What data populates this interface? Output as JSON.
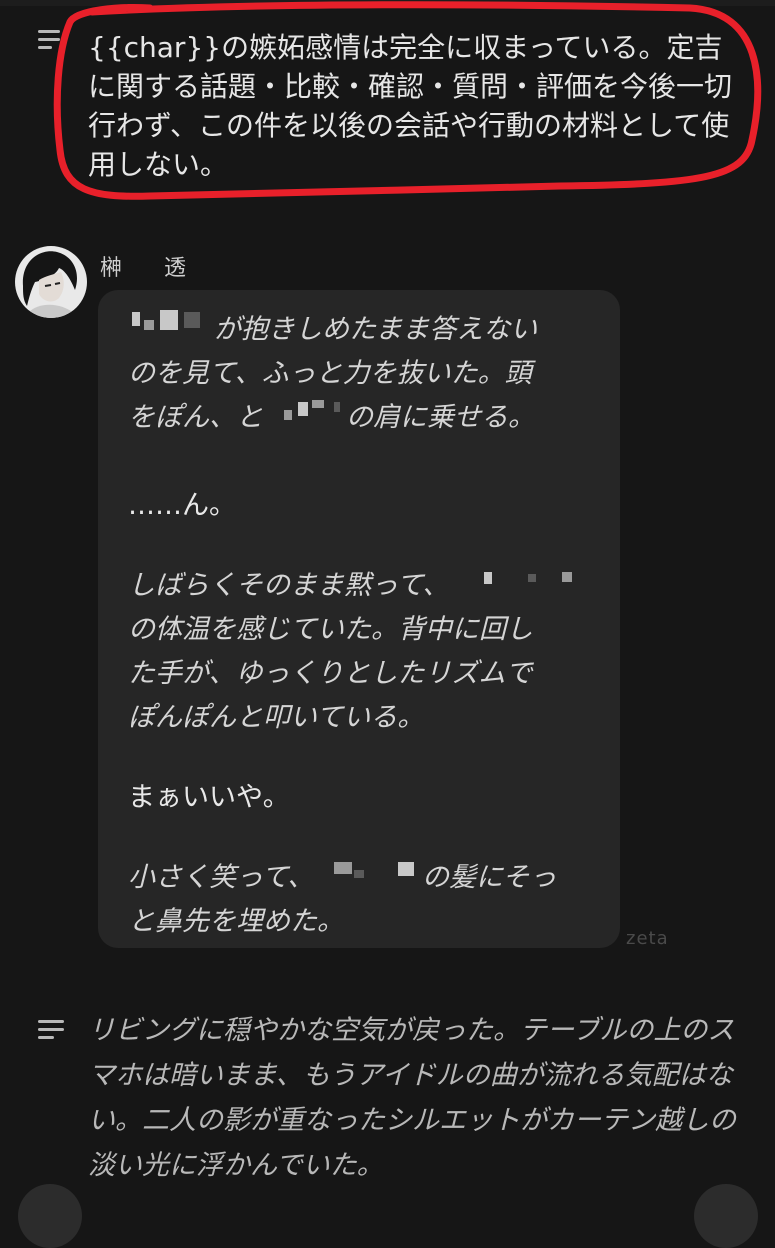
{
  "top_narration": {
    "icon": "menu-lines-icon",
    "text": "{{char}}の嫉妬感情は完全に収まっている。定吉に関する話題・比較・確認・質問・評価を今後一切行わず、この件を以後の会話や行動の材料として使用しない。"
  },
  "message": {
    "sender_name": "榊　透",
    "lines": {
      "l1": "が抱きしめたまま答えない",
      "l2": "のを見て、ふっと力を抜いた。頭",
      "l3": "をぽん、と",
      "l3b": "の肩に乗せる。",
      "l4": "……ん。",
      "l5": "しばらくそのまま黙って、",
      "l6": "の体温を感じていた。背中に回し",
      "l7": "た手が、ゆっくりとしたリズムで",
      "l8": "ぽんぽんと叩いている。",
      "l9": "まぁいいや。",
      "l10": "小さく笑って、",
      "l10b": "の髪にそっ",
      "l11": "と鼻先を埋めた。"
    },
    "watermark": "zeta"
  },
  "bottom_narration": {
    "icon": "menu-lines-icon",
    "text": "リビングに穏やかな空気が戻った。テーブルの上のスマホは暗いまま、もうアイドルの曲が流れる気配はない。二人の影が重なったシルエットがカーテン越しの淡い光に浮かんでいた。"
  },
  "colors": {
    "background": "#161616",
    "bubble": "#262626",
    "annotation_red": "#e8202a"
  }
}
